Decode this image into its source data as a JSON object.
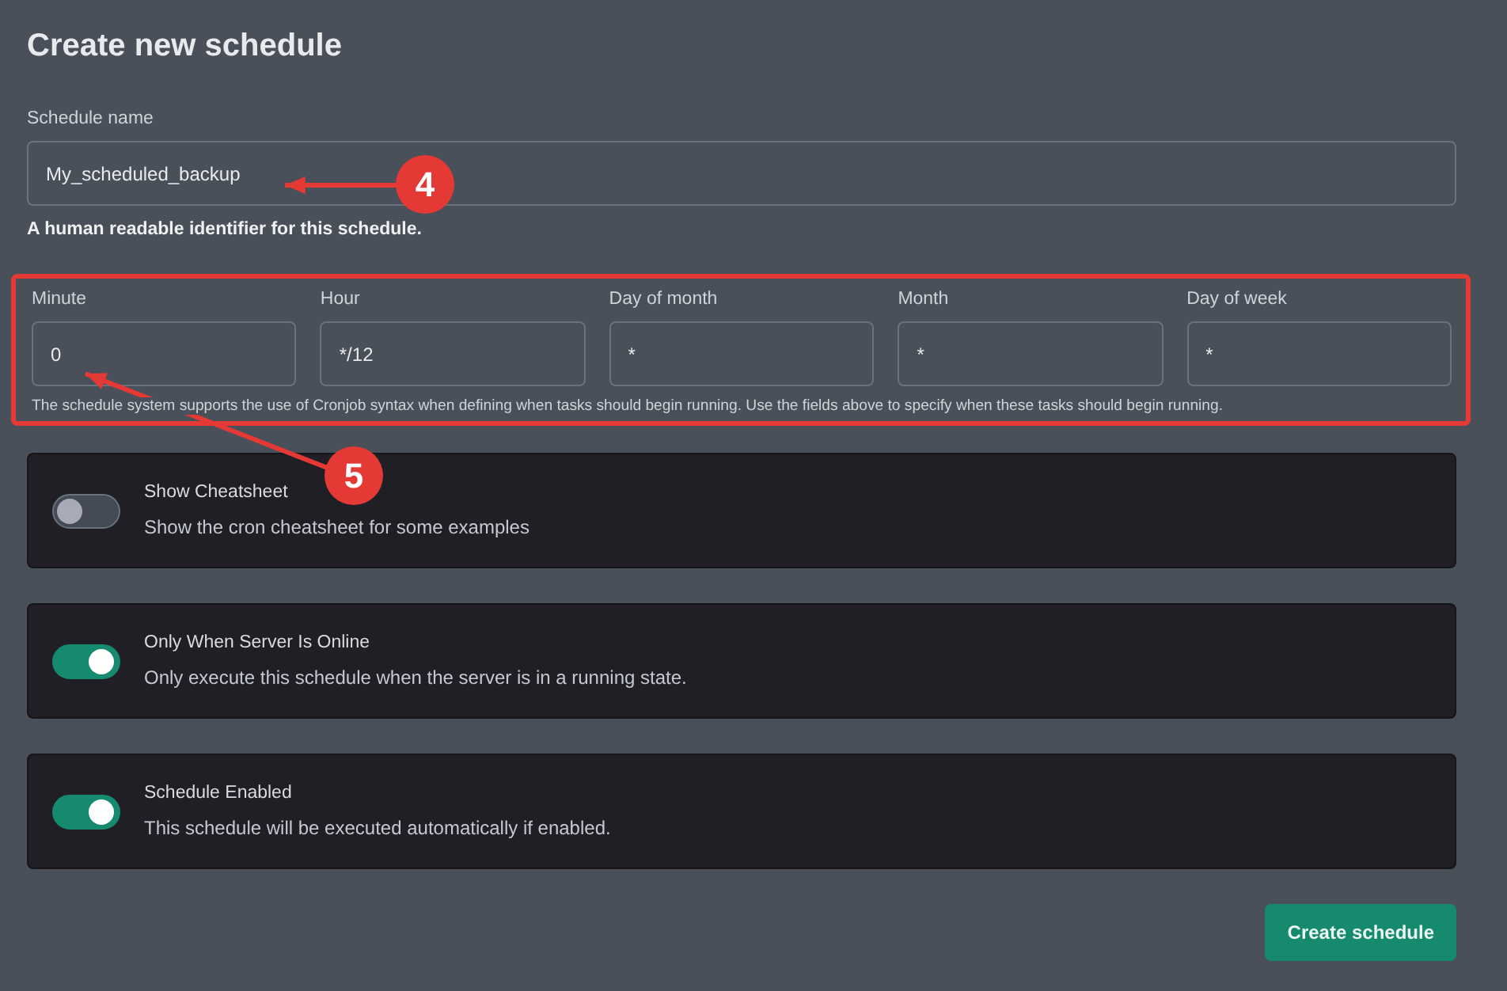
{
  "title": "Create new schedule",
  "schedule_name": {
    "label": "Schedule name",
    "value": "My_scheduled_backup",
    "help": "A human readable identifier for this schedule."
  },
  "cron": {
    "highlighted": true,
    "fields": [
      {
        "label": "Minute",
        "value": "0"
      },
      {
        "label": "Hour",
        "value": "*/12"
      },
      {
        "label": "Day of month",
        "value": "*"
      },
      {
        "label": "Month",
        "value": "*"
      },
      {
        "label": "Day of week",
        "value": "*"
      }
    ],
    "note": "The schedule system supports the use of Cronjob syntax when defining when tasks should begin running. Use the fields above to specify when these tasks should begin running."
  },
  "options": [
    {
      "title": "Show Cheatsheet",
      "description": "Show the cron cheatsheet for some examples",
      "on": false
    },
    {
      "title": "Only When Server Is Online",
      "description": "Only execute this schedule when the server is in a running state.",
      "on": true
    },
    {
      "title": "Schedule Enabled",
      "description": "This schedule will be executed automatically if enabled.",
      "on": true
    }
  ],
  "submit": "Create schedule",
  "annotations": [
    {
      "number": "4"
    },
    {
      "number": "5"
    }
  ]
}
